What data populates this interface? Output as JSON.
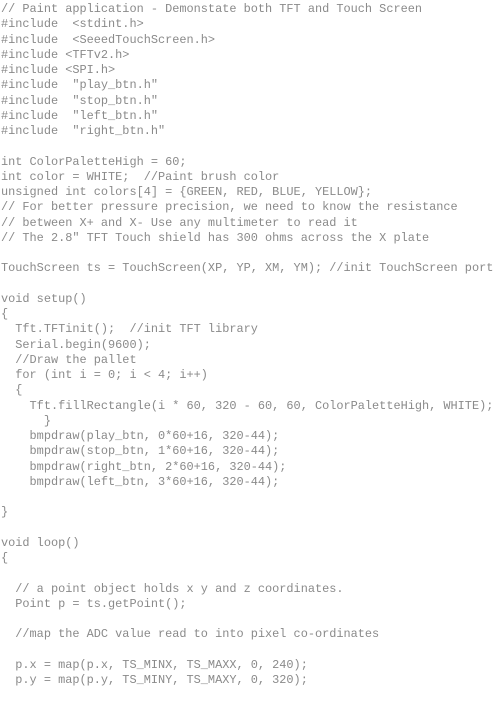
{
  "document": {
    "lines": [
      "// Paint application - Demonstate both TFT and Touch Screen",
      "#include  <stdint.h>",
      "#include  <SeeedTouchScreen.h>",
      "#include <TFTv2.h>",
      "#include <SPI.h>",
      "#include  \"play_btn.h\"",
      "#include  \"stop_btn.h\"",
      "#include  \"left_btn.h\"",
      "#include  \"right_btn.h\"",
      "",
      "int ColorPaletteHigh = 60;",
      "int color = WHITE;  //Paint brush color",
      "unsigned int colors[4] = {GREEN, RED, BLUE, YELLOW};",
      "// For better pressure precision, we need to know the resistance",
      "// between X+ and X- Use any multimeter to read it",
      "// The 2.8\" TFT Touch shield has 300 ohms across the X plate",
      "",
      "TouchScreen ts = TouchScreen(XP, YP, XM, YM); //init TouchScreen port pins",
      "",
      "void setup()",
      "{",
      "  Tft.TFTinit();  //init TFT library",
      "  Serial.begin(9600);",
      "  //Draw the pallet",
      "  for (int i = 0; i < 4; i++)",
      "  {",
      "    Tft.fillRectangle(i * 60, 320 - 60, 60, ColorPaletteHigh, WHITE);",
      "      }",
      "    bmpdraw(play_btn, 0*60+16, 320-44);",
      "    bmpdraw(stop_btn, 1*60+16, 320-44);",
      "    bmpdraw(right_btn, 2*60+16, 320-44);",
      "    bmpdraw(left_btn, 3*60+16, 320-44);",
      "",
      "}",
      "",
      "void loop()",
      "{",
      "",
      "  // a point object holds x y and z coordinates.",
      "  Point p = ts.getPoint();",
      "",
      "  //map the ADC value read to into pixel co-ordinates",
      "",
      "  p.x = map(p.x, TS_MINX, TS_MAXX, 0, 240);",
      "  p.y = map(p.y, TS_MINY, TS_MAXY, 0, 320);"
    ]
  }
}
